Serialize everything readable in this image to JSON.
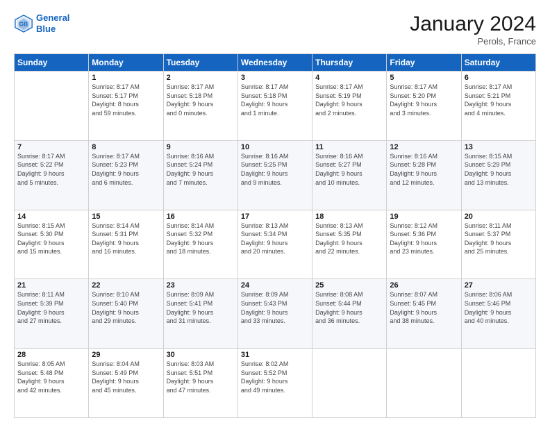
{
  "header": {
    "logo_line1": "General",
    "logo_line2": "Blue",
    "month": "January 2024",
    "location": "Perols, France"
  },
  "weekdays": [
    "Sunday",
    "Monday",
    "Tuesday",
    "Wednesday",
    "Thursday",
    "Friday",
    "Saturday"
  ],
  "weeks": [
    [
      {
        "day": "",
        "info": ""
      },
      {
        "day": "1",
        "info": "Sunrise: 8:17 AM\nSunset: 5:17 PM\nDaylight: 8 hours\nand 59 minutes."
      },
      {
        "day": "2",
        "info": "Sunrise: 8:17 AM\nSunset: 5:18 PM\nDaylight: 9 hours\nand 0 minutes."
      },
      {
        "day": "3",
        "info": "Sunrise: 8:17 AM\nSunset: 5:18 PM\nDaylight: 9 hours\nand 1 minute."
      },
      {
        "day": "4",
        "info": "Sunrise: 8:17 AM\nSunset: 5:19 PM\nDaylight: 9 hours\nand 2 minutes."
      },
      {
        "day": "5",
        "info": "Sunrise: 8:17 AM\nSunset: 5:20 PM\nDaylight: 9 hours\nand 3 minutes."
      },
      {
        "day": "6",
        "info": "Sunrise: 8:17 AM\nSunset: 5:21 PM\nDaylight: 9 hours\nand 4 minutes."
      }
    ],
    [
      {
        "day": "7",
        "info": "Sunrise: 8:17 AM\nSunset: 5:22 PM\nDaylight: 9 hours\nand 5 minutes."
      },
      {
        "day": "8",
        "info": "Sunrise: 8:17 AM\nSunset: 5:23 PM\nDaylight: 9 hours\nand 6 minutes."
      },
      {
        "day": "9",
        "info": "Sunrise: 8:16 AM\nSunset: 5:24 PM\nDaylight: 9 hours\nand 7 minutes."
      },
      {
        "day": "10",
        "info": "Sunrise: 8:16 AM\nSunset: 5:25 PM\nDaylight: 9 hours\nand 9 minutes."
      },
      {
        "day": "11",
        "info": "Sunrise: 8:16 AM\nSunset: 5:27 PM\nDaylight: 9 hours\nand 10 minutes."
      },
      {
        "day": "12",
        "info": "Sunrise: 8:16 AM\nSunset: 5:28 PM\nDaylight: 9 hours\nand 12 minutes."
      },
      {
        "day": "13",
        "info": "Sunrise: 8:15 AM\nSunset: 5:29 PM\nDaylight: 9 hours\nand 13 minutes."
      }
    ],
    [
      {
        "day": "14",
        "info": "Sunrise: 8:15 AM\nSunset: 5:30 PM\nDaylight: 9 hours\nand 15 minutes."
      },
      {
        "day": "15",
        "info": "Sunrise: 8:14 AM\nSunset: 5:31 PM\nDaylight: 9 hours\nand 16 minutes."
      },
      {
        "day": "16",
        "info": "Sunrise: 8:14 AM\nSunset: 5:32 PM\nDaylight: 9 hours\nand 18 minutes."
      },
      {
        "day": "17",
        "info": "Sunrise: 8:13 AM\nSunset: 5:34 PM\nDaylight: 9 hours\nand 20 minutes."
      },
      {
        "day": "18",
        "info": "Sunrise: 8:13 AM\nSunset: 5:35 PM\nDaylight: 9 hours\nand 22 minutes."
      },
      {
        "day": "19",
        "info": "Sunrise: 8:12 AM\nSunset: 5:36 PM\nDaylight: 9 hours\nand 23 minutes."
      },
      {
        "day": "20",
        "info": "Sunrise: 8:11 AM\nSunset: 5:37 PM\nDaylight: 9 hours\nand 25 minutes."
      }
    ],
    [
      {
        "day": "21",
        "info": "Sunrise: 8:11 AM\nSunset: 5:39 PM\nDaylight: 9 hours\nand 27 minutes."
      },
      {
        "day": "22",
        "info": "Sunrise: 8:10 AM\nSunset: 5:40 PM\nDaylight: 9 hours\nand 29 minutes."
      },
      {
        "day": "23",
        "info": "Sunrise: 8:09 AM\nSunset: 5:41 PM\nDaylight: 9 hours\nand 31 minutes."
      },
      {
        "day": "24",
        "info": "Sunrise: 8:09 AM\nSunset: 5:43 PM\nDaylight: 9 hours\nand 33 minutes."
      },
      {
        "day": "25",
        "info": "Sunrise: 8:08 AM\nSunset: 5:44 PM\nDaylight: 9 hours\nand 36 minutes."
      },
      {
        "day": "26",
        "info": "Sunrise: 8:07 AM\nSunset: 5:45 PM\nDaylight: 9 hours\nand 38 minutes."
      },
      {
        "day": "27",
        "info": "Sunrise: 8:06 AM\nSunset: 5:46 PM\nDaylight: 9 hours\nand 40 minutes."
      }
    ],
    [
      {
        "day": "28",
        "info": "Sunrise: 8:05 AM\nSunset: 5:48 PM\nDaylight: 9 hours\nand 42 minutes."
      },
      {
        "day": "29",
        "info": "Sunrise: 8:04 AM\nSunset: 5:49 PM\nDaylight: 9 hours\nand 45 minutes."
      },
      {
        "day": "30",
        "info": "Sunrise: 8:03 AM\nSunset: 5:51 PM\nDaylight: 9 hours\nand 47 minutes."
      },
      {
        "day": "31",
        "info": "Sunrise: 8:02 AM\nSunset: 5:52 PM\nDaylight: 9 hours\nand 49 minutes."
      },
      {
        "day": "",
        "info": ""
      },
      {
        "day": "",
        "info": ""
      },
      {
        "day": "",
        "info": ""
      }
    ]
  ]
}
